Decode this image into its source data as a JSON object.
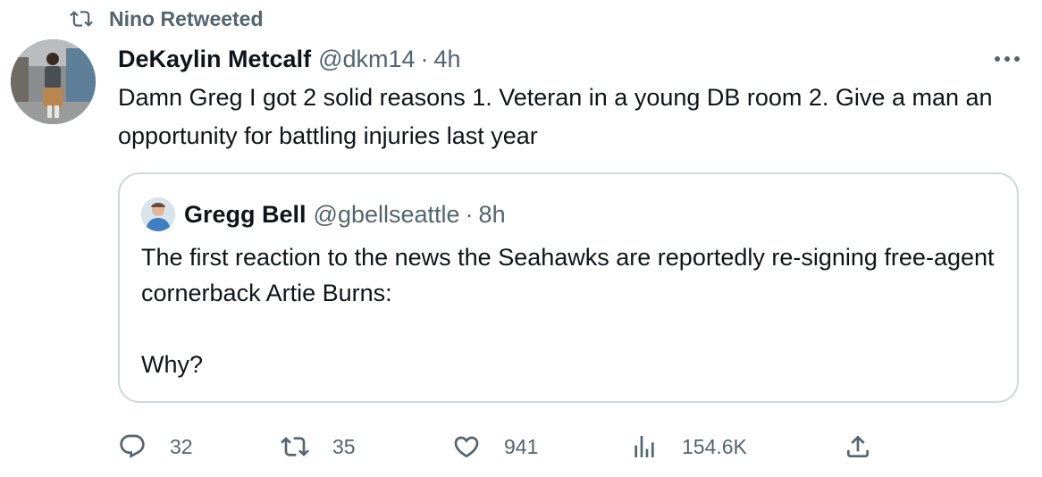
{
  "retweet_banner": {
    "icon": "retweet-icon",
    "text": "Nino Retweeted"
  },
  "tweet": {
    "author_name": "DeKaylin Metcalf",
    "author_handle": "@dkm14",
    "separator": "·",
    "time": "4h",
    "text": "Damn Greg I got 2 solid reasons 1. Veteran in a young DB room 2. Give a man an opportunity for battling injuries last year",
    "more_icon": "more-options-icon"
  },
  "quoted_tweet": {
    "author_name": "Gregg Bell",
    "author_handle": "@gbellseattle",
    "separator": "·",
    "time": "8h",
    "text_line1": "The first reaction to the news the Seahawks are reportedly re-signing free-agent cornerback Artie Burns:",
    "text_line2": "Why?"
  },
  "actions": {
    "replies": "32",
    "retweets": "35",
    "likes": "941",
    "views": "154.6K"
  },
  "colors": {
    "text": "#0f1419",
    "secondary": "#536471",
    "border": "#cfd9de"
  }
}
